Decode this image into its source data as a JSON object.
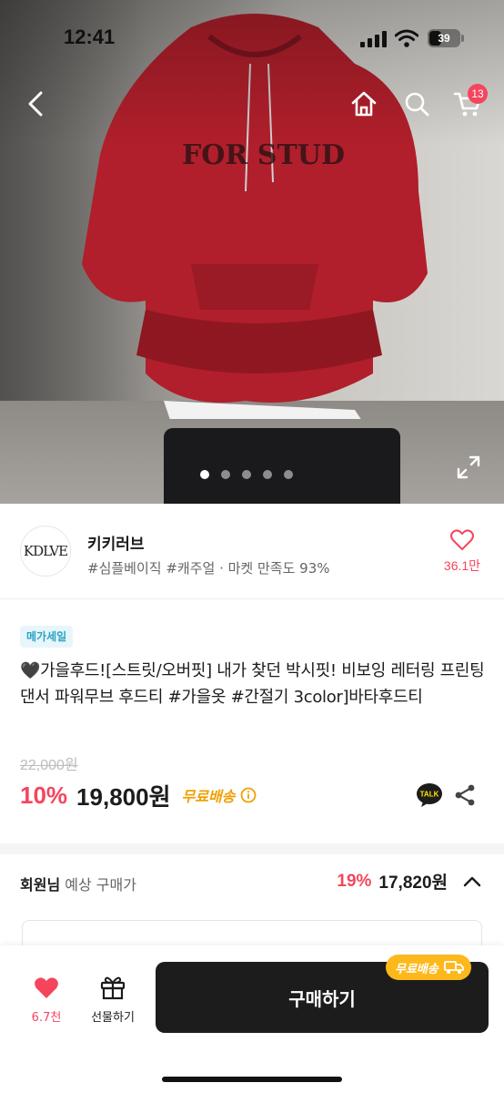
{
  "status_bar": {
    "time": "12:41",
    "battery": "39"
  },
  "nav": {
    "cart_count": "13"
  },
  "hero": {
    "image_count": 5,
    "active_index": 0
  },
  "shop": {
    "logo_text": "KDLVE",
    "name": "키키러브",
    "tags": "#심플베이직 #캐주얼 · 마켓 만족도 93%",
    "like_count": "36.1만"
  },
  "product": {
    "badge": "메가세일",
    "title": "🖤가을후드![스트릿/오버핏] 내가 찾던 박시핏! 비보잉 레터링 프린팅 댄서 파워무브 후드티 #가을옷 #간절기 3color]바타후드티",
    "original_price": "22,000원",
    "discount": "10%",
    "price": "19,800원",
    "shipping": "무료배송",
    "talk_label": "TALK"
  },
  "member": {
    "label_bold": "회원님",
    "label_rest": " 예상 구매가",
    "discount": "19%",
    "price": "17,820원"
  },
  "bottom_bar": {
    "like_count": "6.7천",
    "gift_label": "선물하기",
    "buy_label": "구매하기",
    "ship_tag": "무료배송"
  },
  "colors": {
    "accent": "#f5455c",
    "shipping": "#f0a000",
    "badge_text": "#2aa2c6",
    "buy_button": "#1c1c1c"
  }
}
